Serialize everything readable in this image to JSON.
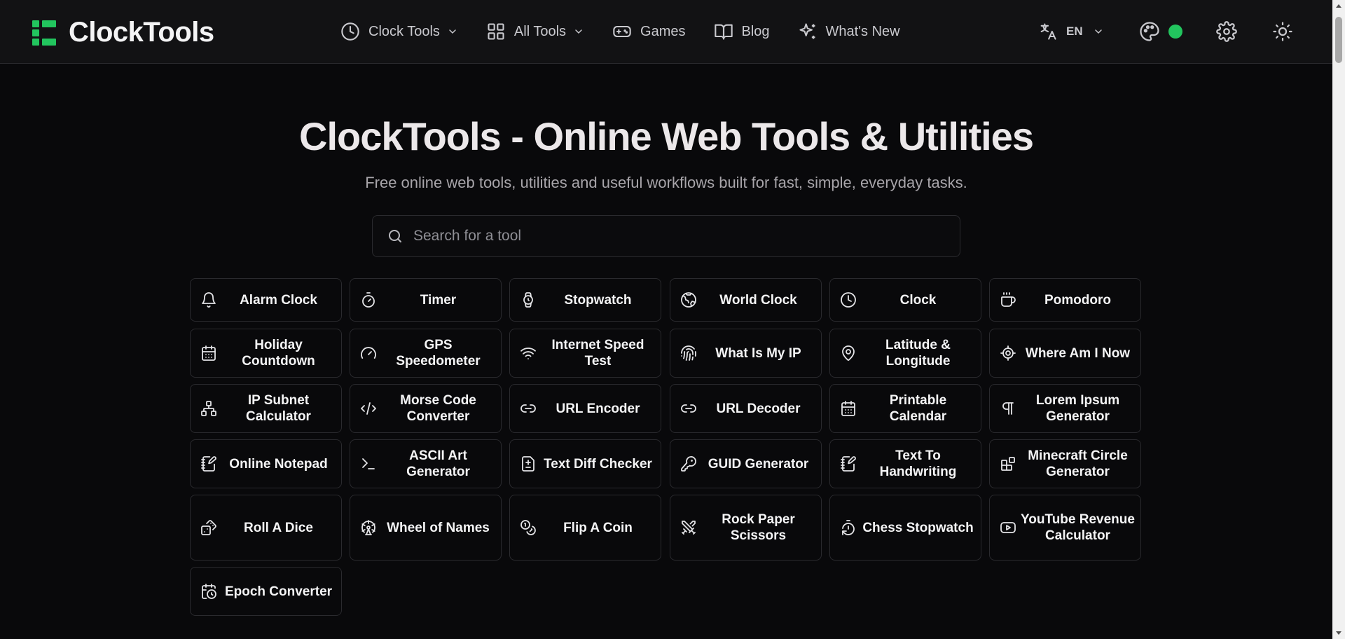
{
  "header": {
    "logo_text": "ClockTools",
    "brand_color": "#22c55e",
    "nav": [
      {
        "label": "Clock Tools",
        "icon": "clock-icon",
        "dropdown": true
      },
      {
        "label": "All Tools",
        "icon": "grid-icon",
        "dropdown": true
      },
      {
        "label": "Games",
        "icon": "gamepad-icon",
        "dropdown": false
      },
      {
        "label": "Blog",
        "icon": "book-icon",
        "dropdown": false
      },
      {
        "label": "What's New",
        "icon": "sparkles-icon",
        "dropdown": false
      }
    ],
    "language": {
      "code": "EN",
      "icon": "translate-icon"
    },
    "theme_color_indicator": "#22c55e"
  },
  "hero": {
    "title": "ClockTools - Online Web Tools & Utilities",
    "subtitle": "Free online web tools, utilities and useful workflows built for fast, simple, everyday tasks."
  },
  "search": {
    "placeholder": "Search for a tool",
    "value": ""
  },
  "tools": [
    {
      "label": "Alarm Clock",
      "icon": "bell-icon"
    },
    {
      "label": "Timer",
      "icon": "timer-icon"
    },
    {
      "label": "Stopwatch",
      "icon": "watch-icon"
    },
    {
      "label": "World Clock",
      "icon": "globe-icon"
    },
    {
      "label": "Clock",
      "icon": "clock-icon"
    },
    {
      "label": "Pomodoro",
      "icon": "coffee-icon"
    },
    {
      "label": "Holiday Countdown",
      "icon": "calendar-icon"
    },
    {
      "label": "GPS Speedometer",
      "icon": "gauge-icon"
    },
    {
      "label": "Internet Speed Test",
      "icon": "wifi-icon"
    },
    {
      "label": "What Is My IP",
      "icon": "fingerprint-icon"
    },
    {
      "label": "Latitude & Longitude",
      "icon": "map-pin-icon"
    },
    {
      "label": "Where Am I Now",
      "icon": "locate-icon"
    },
    {
      "label": "IP Subnet Calculator",
      "icon": "network-icon"
    },
    {
      "label": "Morse Code Converter",
      "icon": "code-icon"
    },
    {
      "label": "URL Encoder",
      "icon": "link-icon"
    },
    {
      "label": "URL Decoder",
      "icon": "link-icon"
    },
    {
      "label": "Printable Calendar",
      "icon": "calendar-icon"
    },
    {
      "label": "Lorem Ipsum Generator",
      "icon": "pilcrow-icon"
    },
    {
      "label": "Online Notepad",
      "icon": "notepad-icon"
    },
    {
      "label": "ASCII Art Generator",
      "icon": "terminal-icon"
    },
    {
      "label": "Text Diff Checker",
      "icon": "file-diff-icon"
    },
    {
      "label": "GUID Generator",
      "icon": "key-icon"
    },
    {
      "label": "Text To Handwriting",
      "icon": "notepad-pen-icon"
    },
    {
      "label": "Minecraft Circle Generator",
      "icon": "blocks-icon"
    },
    {
      "label": "Roll A Dice",
      "icon": "dice-icon"
    },
    {
      "label": "Wheel of Names",
      "icon": "ferris-wheel-icon"
    },
    {
      "label": "Flip A Coin",
      "icon": "coins-icon"
    },
    {
      "label": "Rock Paper Scissors",
      "icon": "swords-icon"
    },
    {
      "label": "Chess Stopwatch",
      "icon": "timer-reset-icon"
    },
    {
      "label": "YouTube Revenue Calculator",
      "icon": "youtube-icon"
    },
    {
      "label": "Epoch Converter",
      "icon": "calendar-clock-icon"
    }
  ]
}
